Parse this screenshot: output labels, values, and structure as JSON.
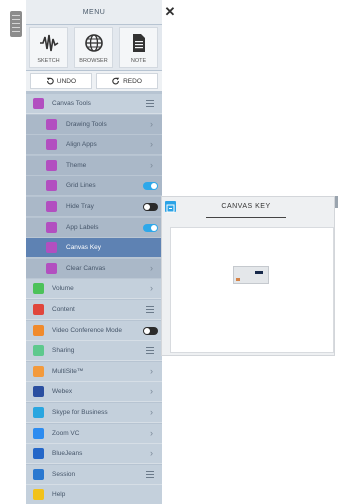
{
  "menu": {
    "title": "MENU",
    "close_symbol": "✕",
    "quick_buttons": [
      {
        "label": "SKETCH",
        "icon": "sketch-waveform-icon"
      },
      {
        "label": "BROWSER",
        "icon": "globe-icon"
      },
      {
        "label": "NOTE",
        "icon": "note-document-icon"
      }
    ],
    "undo_label": "UNDO",
    "redo_label": "REDO",
    "items": [
      {
        "label": "Canvas Tools",
        "level": "main",
        "icon_color": "#b24fc0",
        "control": "list"
      },
      {
        "label": "Drawing Tools",
        "level": "sub",
        "icon_color": "#b24fc0",
        "control": "chevron"
      },
      {
        "label": "Align Apps",
        "level": "sub",
        "icon_color": "#b24fc0",
        "control": "chevron"
      },
      {
        "label": "Theme",
        "level": "sub",
        "icon_color": "#b24fc0",
        "control": "chevron"
      },
      {
        "label": "Grid Lines",
        "level": "sub",
        "icon_color": "#b24fc0",
        "control": "toggle",
        "toggle_on": true
      },
      {
        "label": "Hide Tray",
        "level": "sub",
        "icon_color": "#b24fc0",
        "control": "toggle",
        "toggle_on": false
      },
      {
        "label": "App Labels",
        "level": "sub",
        "icon_color": "#b24fc0",
        "control": "toggle",
        "toggle_on": true
      },
      {
        "label": "Canvas Key",
        "level": "sub",
        "icon_color": "#b24fc0",
        "control": "none",
        "active": true
      },
      {
        "label": "Clear Canvas",
        "level": "sub",
        "icon_color": "#b24fc0",
        "control": "chevron"
      },
      {
        "label": "Volume",
        "level": "main",
        "icon_color": "#4cc25a",
        "control": "chevron"
      },
      {
        "label": "Content",
        "level": "main",
        "icon_color": "#e0463c",
        "control": "list"
      },
      {
        "label": "Video Conference Mode",
        "level": "main",
        "icon_color": "#f08a2c",
        "control": "toggle",
        "toggle_on": false
      },
      {
        "label": "Sharing",
        "level": "main",
        "icon_color": "#5ec98d",
        "control": "list"
      },
      {
        "label": "MultiSite™",
        "level": "main",
        "icon_color": "#f39a3c",
        "control": "chevron"
      },
      {
        "label": "Webex",
        "level": "main",
        "icon_color": "#2b4fa0",
        "control": "chevron"
      },
      {
        "label": "Skype for Business",
        "level": "main",
        "icon_color": "#2aa6e0",
        "control": "chevron"
      },
      {
        "label": "Zoom VC",
        "level": "main",
        "icon_color": "#2d8cf0",
        "control": "chevron"
      },
      {
        "label": "BlueJeans",
        "level": "main",
        "icon_color": "#2567c8",
        "control": "chevron"
      },
      {
        "label": "Session",
        "level": "main",
        "icon_color": "#2a78d0",
        "control": "list"
      },
      {
        "label": "Help",
        "level": "main",
        "icon_color": "#f2c21b",
        "control": "none"
      }
    ]
  },
  "canvas_key": {
    "title": "CANVAS KEY"
  },
  "colors": {
    "accent_toggle": "#2ea8ea",
    "active_row": "#5e82b3",
    "panel_bg": "#b7c4d2"
  }
}
